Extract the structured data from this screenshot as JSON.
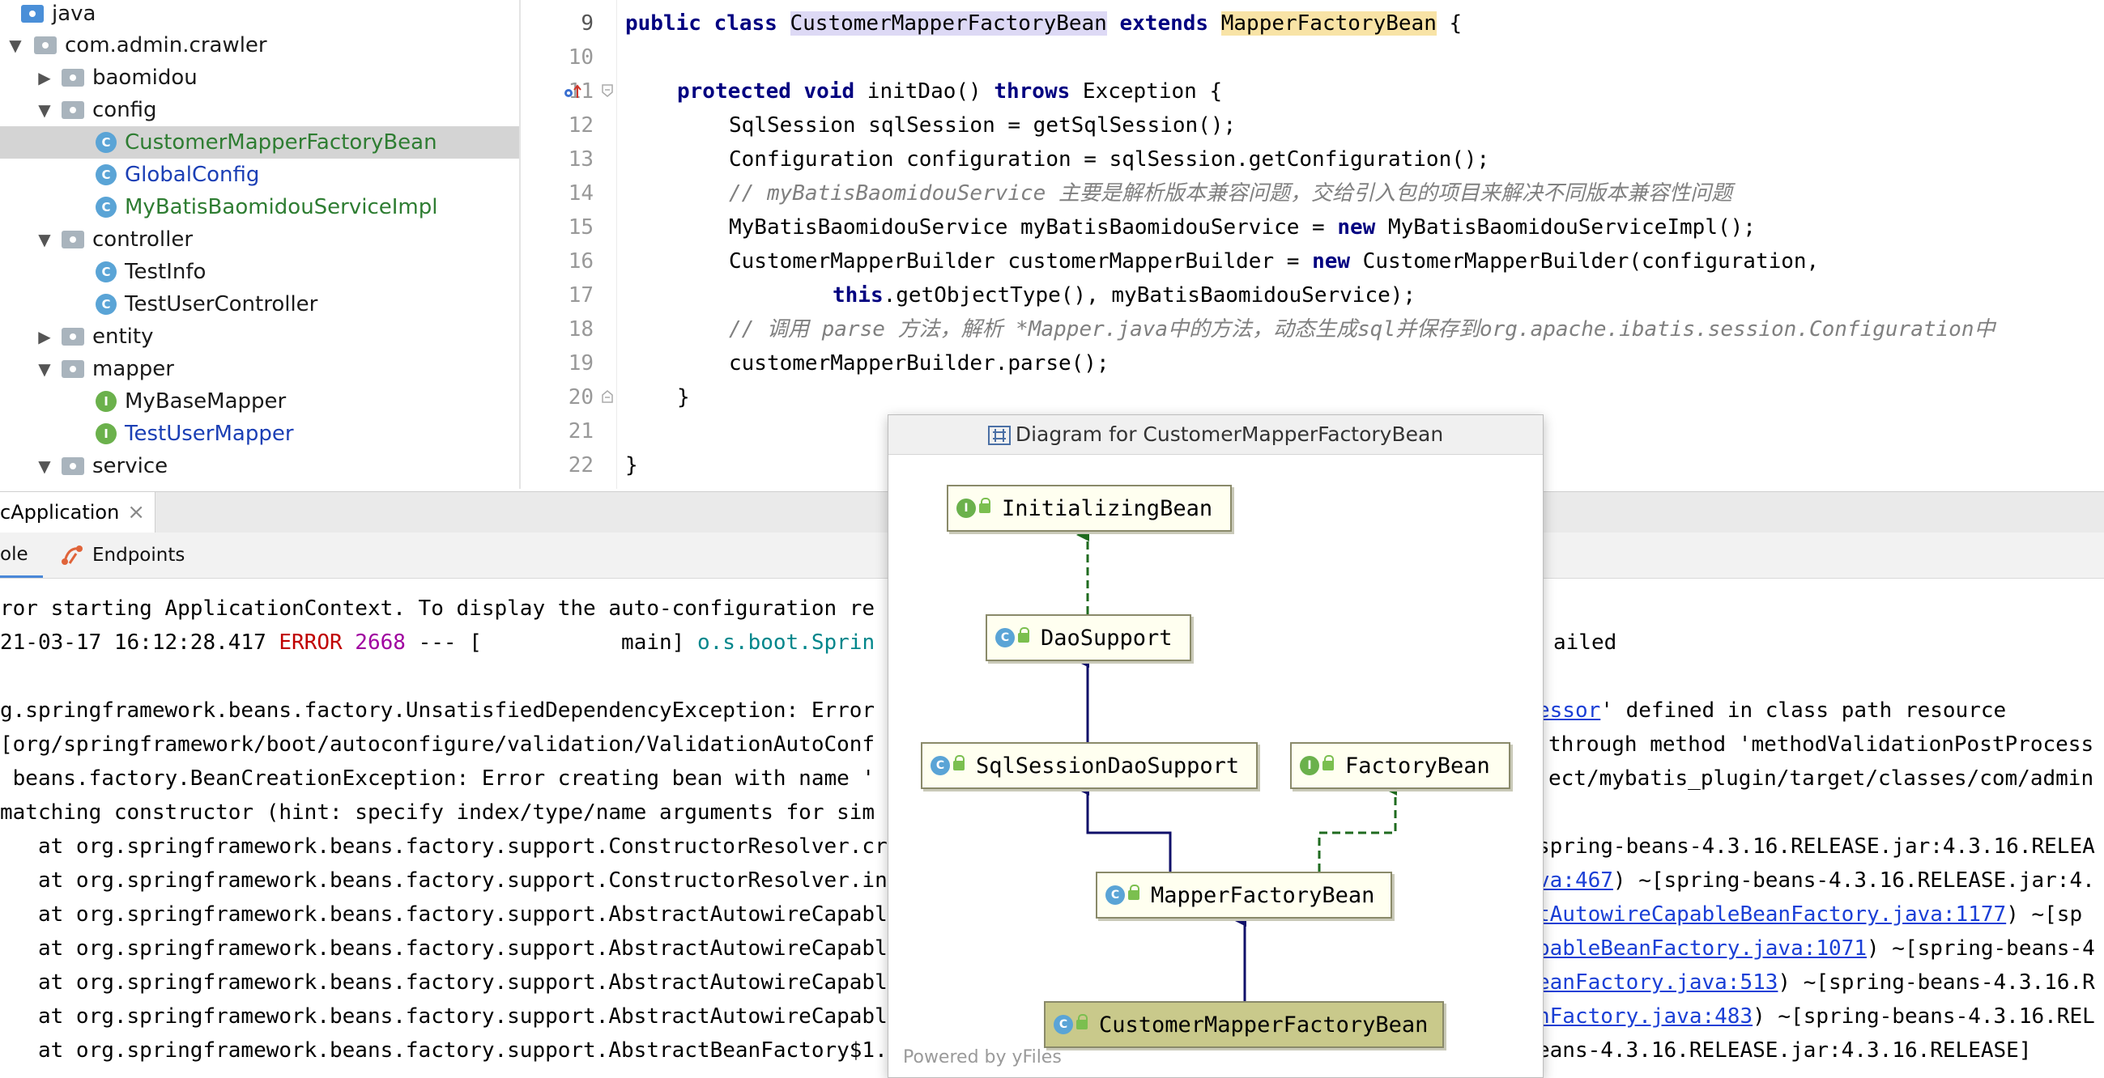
{
  "project_tree": {
    "items": [
      {
        "label": "java",
        "kind": "folder-java"
      },
      {
        "label": "com.admin.crawler",
        "kind": "package",
        "expanded": true
      },
      {
        "label": "baomidou",
        "kind": "package",
        "expanded": false
      },
      {
        "label": "config",
        "kind": "package",
        "expanded": true
      },
      {
        "label": "CustomerMapperFactoryBean",
        "kind": "class",
        "selected": true
      },
      {
        "label": "GlobalConfig",
        "kind": "class"
      },
      {
        "label": "MyBatisBaomidouServiceImpl",
        "kind": "class"
      },
      {
        "label": "controller",
        "kind": "package",
        "expanded": true
      },
      {
        "label": "TestInfo",
        "kind": "class"
      },
      {
        "label": "TestUserController",
        "kind": "class"
      },
      {
        "label": "entity",
        "kind": "package",
        "expanded": false
      },
      {
        "label": "mapper",
        "kind": "package",
        "expanded": true
      },
      {
        "label": "MyBaseMapper",
        "kind": "interface"
      },
      {
        "label": "TestUserMapper",
        "kind": "interface"
      },
      {
        "label": "service",
        "kind": "package",
        "expanded": true
      }
    ]
  },
  "editor": {
    "line_numbers": [
      "9",
      "10",
      "11",
      "12",
      "13",
      "14",
      "15",
      "16",
      "17",
      "18",
      "19",
      "20",
      "21",
      "22"
    ],
    "line9": {
      "kw": "public class",
      "name": "CustomerMapperFactoryBean",
      "ext": "extends",
      "parent": "MapperFactoryBean",
      "brace": " {"
    },
    "line11": {
      "kw": "protected void",
      "rest1": " initDao() ",
      "kw2": "throws",
      "rest2": " Exception {"
    },
    "line12": "SqlSession sqlSession = getSqlSession();",
    "line13": "Configuration configuration = sqlSession.getConfiguration();",
    "line14": "// myBatisBaomidouService 主要是解析版本兼容问题，交给引入包的项目来解决不同版本兼容性问题",
    "line15": {
      "a": "MyBatisBaomidouService myBatisBaomidouService = ",
      "kw": "new",
      "b": " MyBatisBaomidouServiceImpl();"
    },
    "line16": {
      "a": "CustomerMapperBuilder customerMapperBuilder = ",
      "kw": "new",
      "b": " CustomerMapperBuilder(configuration,"
    },
    "line17": {
      "kw": "this",
      "b": ".getObjectType(), myBatisBaomidouService);"
    },
    "line18": "// 调用 parse 方法，解析 *Mapper.java中的方法，动态生成sql并保存到org.apache.ibatis.session.Configuration中",
    "line19": "customerMapperBuilder.parse();",
    "line20": "}",
    "line22": "}"
  },
  "run_tab": {
    "label": "cApplication",
    "close": "×"
  },
  "console_tabs": {
    "console": "ole",
    "endpoints": "Endpoints"
  },
  "console": {
    "l1": "ror starting ApplicationContext. To display the auto-configuration re",
    "l2": {
      "ts": "21-03-17 16:12:28.417 ",
      "level": "ERROR",
      "pid": " 2668",
      "sep": " --- [           main] ",
      "logger": "o.s.boot.Sprin",
      "tail": "ailed"
    },
    "l3": {
      "a": "g.springframework.beans.factory.UnsatisfiedDependencyException: Error",
      "link": "essor",
      "b": "' defined in class path resource"
    },
    "l4": {
      "a": "[org/springframework/boot/autoconfigure/validation/ValidationAutoConf",
      "b": "through method 'methodValidationPostProcess"
    },
    "l5": {
      "a": " beans.factory.BeanCreationException: Error creating bean with name '",
      "b": "ect/mybatis_plugin/target/classes/com/admin"
    },
    "l6": "matching constructor (hint: specify index/type/name arguments for sim",
    "stack": [
      {
        "a": "   at org.springframework.beans.factory.support.ConstructorResolver.cr",
        "link": "",
        "b": "spring-beans-4.3.16.RELEASE.jar:4.3.16.RELEA"
      },
      {
        "a": "   at org.springframework.beans.factory.support.ConstructorResolver.in",
        "link": "va:467",
        "b": ") ~[spring-beans-4.3.16.RELEASE.jar:4."
      },
      {
        "a": "   at org.springframework.beans.factory.support.AbstractAutowireCapabl",
        "link": "tAutowireCapableBeanFactory.java:1177",
        "b": ") ~[sp"
      },
      {
        "a": "   at org.springframework.beans.factory.support.AbstractAutowireCapabl",
        "link": "pableBeanFactory.java:1071",
        "b": ") ~[spring-beans-4"
      },
      {
        "a": "   at org.springframework.beans.factory.support.AbstractAutowireCapabl",
        "link": "eanFactory.java:513",
        "b": ") ~[spring-beans-4.3.16.R"
      },
      {
        "a": "   at org.springframework.beans.factory.support.AbstractAutowireCapabl",
        "link": "nFactory.java:483",
        "b": ") ~[spring-beans-4.3.16.REL"
      },
      {
        "a": "   at org.springframework.beans.factory.support.AbstractBeanFactory$1.",
        "link": "",
        "b": "eans-4.3.16.RELEASE.jar:4.3.16.RELEASE]"
      }
    ]
  },
  "diagram": {
    "title": "Diagram for CustomerMapperFactoryBean",
    "nodes": [
      {
        "id": "initializing-bean",
        "label": "InitializingBean",
        "type": "I"
      },
      {
        "id": "dao-support",
        "label": "DaoSupport",
        "type": "C"
      },
      {
        "id": "sql-session-dao-support",
        "label": "SqlSessionDaoSupport",
        "type": "C"
      },
      {
        "id": "factory-bean",
        "label": "FactoryBean",
        "type": "I"
      },
      {
        "id": "mapper-factory-bean",
        "label": "MapperFactoryBean",
        "type": "C"
      },
      {
        "id": "customer-mapper-factory-bean",
        "label": "CustomerMapperFactoryBean",
        "type": "C"
      }
    ],
    "footer": "Powered by yFiles"
  },
  "colors": {
    "keyword": "#000080",
    "comment": "#808080",
    "error": "#c00000",
    "extends_arrow": "#1a1a80",
    "implements_arrow": "#1f6b1f"
  }
}
